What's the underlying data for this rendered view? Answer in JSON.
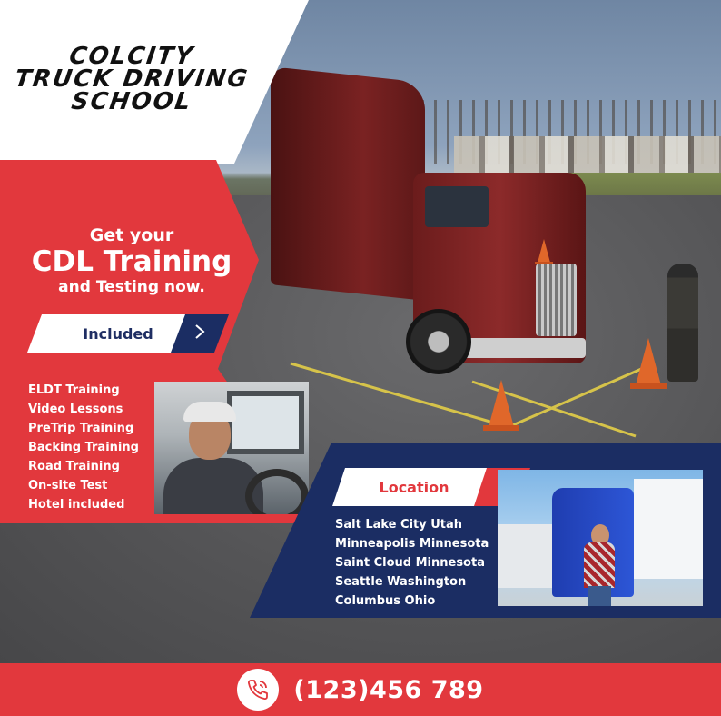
{
  "brand": {
    "title_lines": [
      "COLCITY",
      "TRUCK DRIVING",
      "SCHOOL"
    ]
  },
  "promo": {
    "line1": "Get your",
    "line2": "CDL Training",
    "line3": "and Testing now."
  },
  "included": {
    "label": "Included",
    "items": [
      "ELDT Training",
      "Video Lessons",
      "PreTrip Training",
      "Backing Training",
      "Road Training",
      "On-site Test",
      "Hotel included"
    ]
  },
  "location": {
    "label": "Location",
    "cities": [
      "Salt Lake City Utah",
      "Minneapolis Minnesota",
      "Saint Cloud Minnesota",
      "Seattle Washington",
      "Columbus Ohio"
    ]
  },
  "contact": {
    "phone": "(123)456 789",
    "icon": "phone-icon"
  },
  "colors": {
    "brand_red": "#e2383d",
    "brand_navy": "#1b2d63",
    "white": "#ffffff"
  }
}
